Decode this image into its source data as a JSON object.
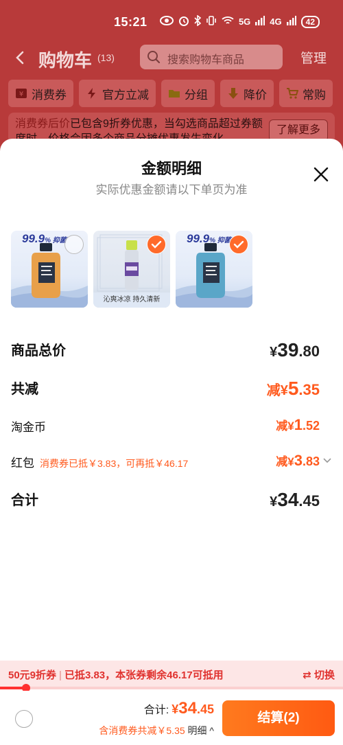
{
  "status_bar": {
    "time": "15:21",
    "signal_1": "5G",
    "signal_2": "4G",
    "battery": "42"
  },
  "nav": {
    "title": "购物车",
    "count": "(13)",
    "search_placeholder": "搜索购物车商品",
    "manage": "管理"
  },
  "filters": [
    "消费券",
    "官方立减",
    "分组",
    "降价",
    "常购"
  ],
  "notice": {
    "highlight": "消费券后价",
    "text": "已包含9折券优惠，当勾选商品超过券额度时，价格会因多个商品分摊优惠发生变化",
    "button": "了解更多"
  },
  "sheet": {
    "title": "金额明细",
    "subtitle": "实际优惠金额请以下单页为准",
    "products": [
      {
        "brand": "99.9",
        "brand_suffix": "% 抑菌",
        "checked": false,
        "caption": ""
      },
      {
        "brand": "",
        "brand_suffix": "",
        "checked": true,
        "caption": "沁爽冰凉  持久清新"
      },
      {
        "brand": "99.9",
        "brand_suffix": "% 抑菌",
        "checked": true,
        "caption": ""
      }
    ],
    "rows": {
      "total": {
        "label": "商品总价",
        "currency": "¥",
        "int": "39",
        "dec": ".80"
      },
      "discount": {
        "label": "共减",
        "prefix": "减¥",
        "int": "5",
        "dec": ".35"
      },
      "coin": {
        "label": "淘金币",
        "prefix": "减¥",
        "int": "1",
        "dec": ".52"
      },
      "redpack": {
        "label": "红包",
        "note": "消费券已抵￥3.83，可再抵￥46.17",
        "prefix": "减¥",
        "int": "3",
        "dec": ".83"
      },
      "sum": {
        "label": "合计",
        "currency": "¥",
        "int": "34",
        "dec": ".45"
      }
    }
  },
  "coupon_bar": {
    "name": "50元9折券",
    "info": "已抵3.83，本张券剩余46.17可抵用",
    "switch": "⇄ 切换",
    "progress": 0.076
  },
  "checkout": {
    "sum_label": "合计:",
    "currency": "¥",
    "int": "34",
    "dec": ".45",
    "sub_text": "含消费券共减￥5.35",
    "detail": "明细 ^",
    "pay_button": "结算(2)"
  },
  "colors": {
    "accent": "#ff5a1e",
    "coupon_red": "#e0322f",
    "header_dim": "#b83a3a"
  }
}
